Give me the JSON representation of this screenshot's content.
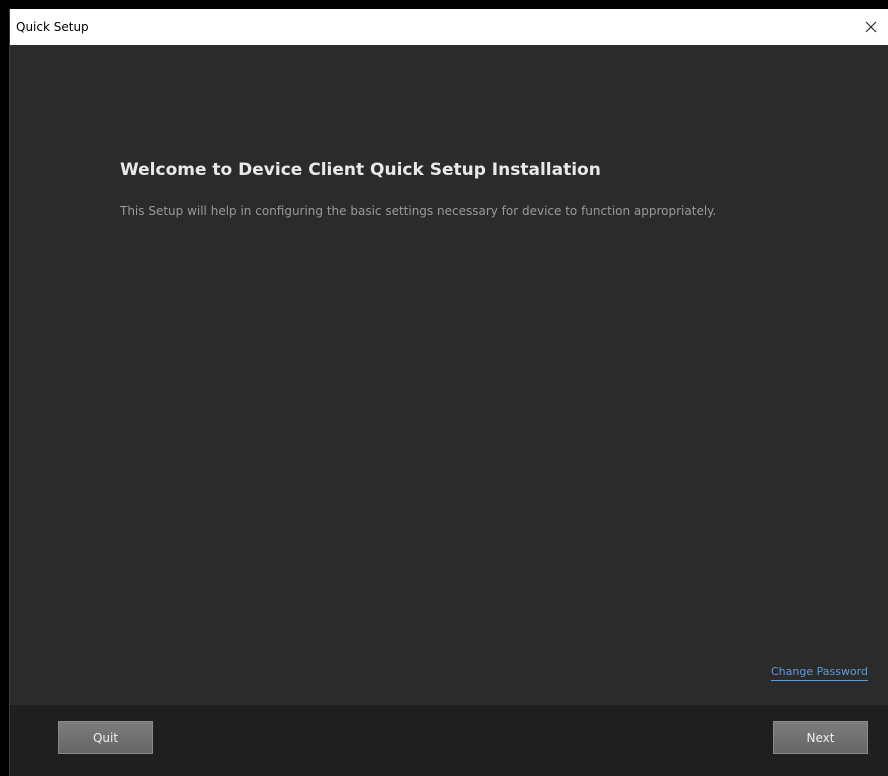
{
  "window": {
    "title": "Quick Setup",
    "close_icon": "close-icon"
  },
  "welcome": {
    "heading": "Welcome to Device Client Quick Setup Installation",
    "description": "This Setup will help in configuring the basic settings necessary for device to function appropriately."
  },
  "links": {
    "change_password": "Change Password"
  },
  "footer": {
    "quit_label": "Quit",
    "next_label": "Next"
  },
  "colors": {
    "background": "#2b2b2b",
    "footer": "#1f1f1f",
    "link": "#5e9bd6",
    "button": "#737373"
  }
}
